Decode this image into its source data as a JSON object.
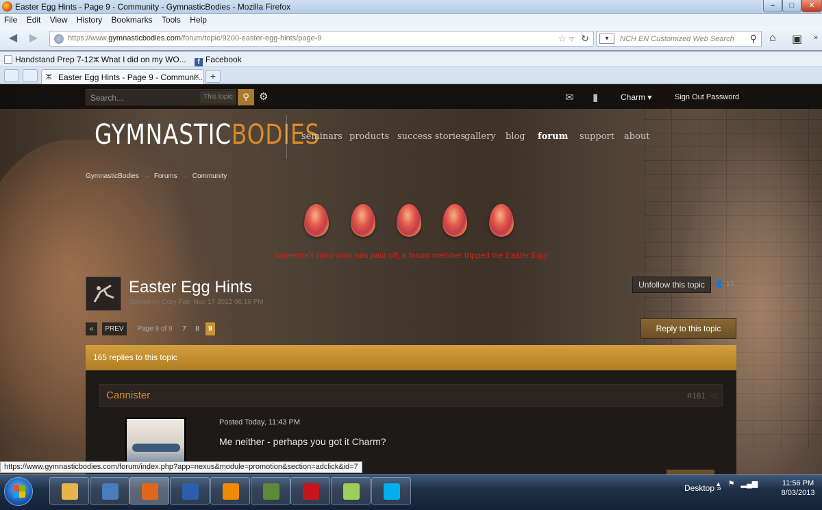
{
  "window": {
    "title": "Easter Egg Hints - Page 9 - Community - GymnasticBodies - Mozilla Firefox",
    "controls": {
      "minimize": "–",
      "maximize": "□",
      "close": "✕"
    }
  },
  "menu": [
    "File",
    "Edit",
    "View",
    "History",
    "Bookmarks",
    "Tools",
    "Help"
  ],
  "nav": {
    "url_prefix": "https://www.",
    "url_domain": "gymnasticbodies.com",
    "url_path": "/forum/topic/9200-easter-egg-hints/page-9",
    "search_placeholder": "NCH EN Customized Web Search"
  },
  "bookmarks": [
    {
      "label": "Handstand Prep 7-12",
      "icon": "blank-page-icon"
    },
    {
      "label": "What I did on my WO...",
      "icon": "gb-favicon"
    },
    {
      "label": "Facebook",
      "icon": "facebook-icon"
    }
  ],
  "tab": {
    "label": "Easter Egg Hints - Page 9 - Communi...",
    "close": "×",
    "new": "+"
  },
  "site": {
    "search_placeholder": "Search...",
    "search_scope": "This topic",
    "user": "Charm ▾",
    "signout": "Sign Out Password",
    "logo_part1": "GYMNASTIC",
    "logo_part2": "BODIES",
    "main_nav": [
      "seminars",
      "products",
      "success stories",
      "gallery",
      "blog",
      "forum",
      "support",
      "about"
    ],
    "active_nav": "forum",
    "breadcrumbs": [
      "GymnasticBodies",
      "Forums",
      "Community"
    ],
    "egg_message": "Someone's hard work has paid off, a forum member tripped the Easter Egg!"
  },
  "topic": {
    "title": "Easter Egg Hints",
    "meta": "Started by Cory Fair, Nov 17 2012 06:16 PM",
    "follow_label": "Unfollow this topic",
    "followers": "15",
    "reply_label": "Reply to this topic",
    "replies_text": "165 replies to this topic",
    "pagination": {
      "first": "«",
      "prev": "PREV",
      "info": "Page 9 of 9",
      "pages": [
        "7",
        "8",
        "9"
      ],
      "current": "9"
    }
  },
  "post": {
    "author": "Cannister",
    "number": "#161",
    "posted": "Posted Today, 11:43 PM",
    "body": "Me neither - perhaps you got it Charm?"
  },
  "statusbar": "https://www.gymnasticbodies.com/forum/index.php?app=nexus&module=promotion&section=adclick&id=7",
  "taskbar": {
    "apps": [
      {
        "name": "explorer",
        "color": "#e8b54a"
      },
      {
        "name": "outlook",
        "color": "#4a7bbd"
      },
      {
        "name": "firefox",
        "color": "#e2661a"
      },
      {
        "name": "word",
        "color": "#2b5fad"
      },
      {
        "name": "vlc",
        "color": "#f08a00"
      },
      {
        "name": "calculator",
        "color": "#5a8a3a"
      },
      {
        "name": "acrobat",
        "color": "#c4161c"
      },
      {
        "name": "sticky-notes",
        "color": "#9ccf5a"
      },
      {
        "name": "skype",
        "color": "#00aff0"
      }
    ],
    "desktop_label": "Desktop",
    "time": "11:56 PM",
    "date": "8/03/2013"
  }
}
